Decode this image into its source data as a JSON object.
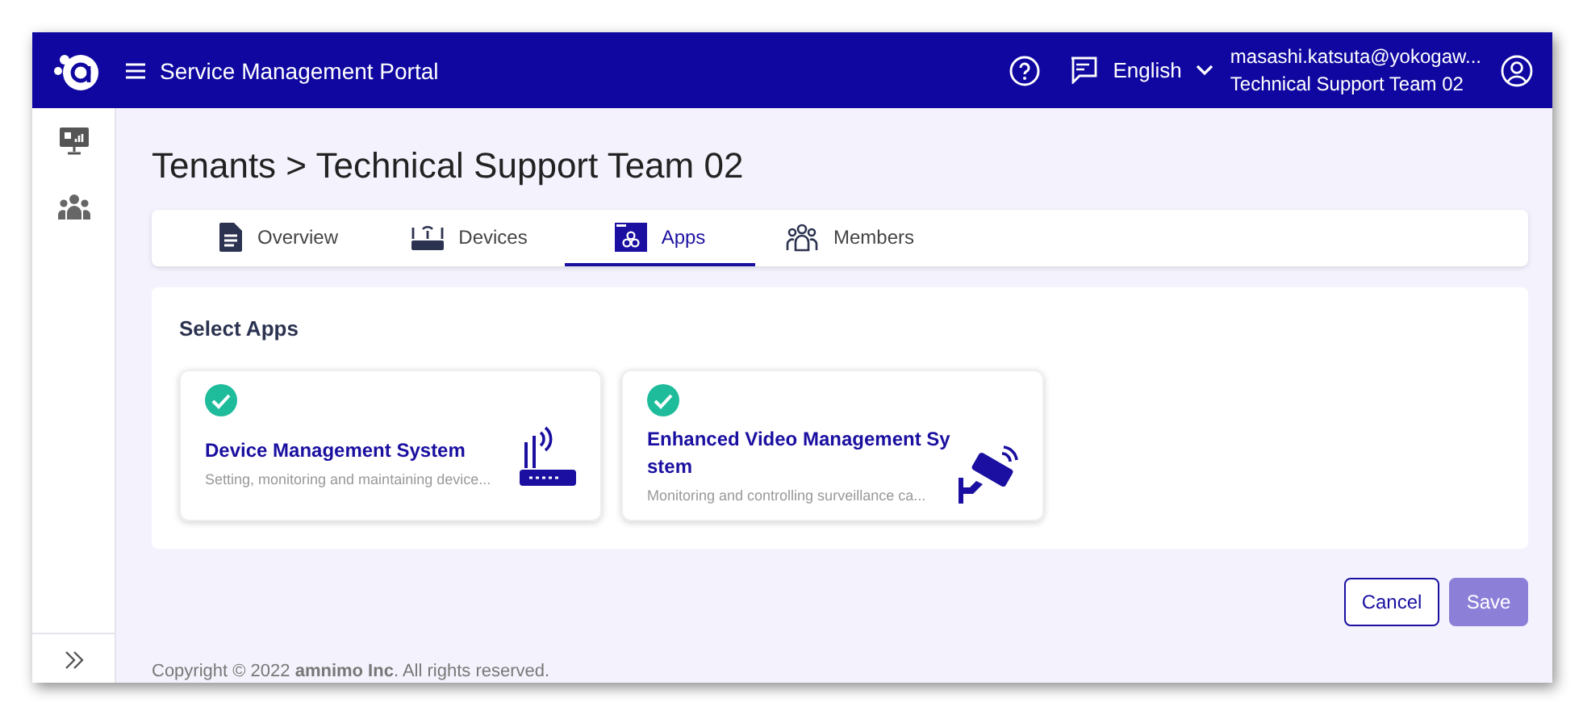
{
  "header": {
    "title": "Service Management Portal",
    "language": "English",
    "user_email": "masashi.katsuta@yokogaw...",
    "user_team": "Technical Support Team 02"
  },
  "sidebar": {
    "items": [
      {
        "kind": "monitor"
      },
      {
        "kind": "people"
      }
    ]
  },
  "breadcrumb": "Tenants > Technical Support Team 02",
  "tabs": [
    {
      "label": "Overview",
      "kind": "document",
      "selected": false
    },
    {
      "label": "Devices",
      "kind": "router",
      "selected": false
    },
    {
      "label": "Apps",
      "kind": "apps",
      "selected": true
    },
    {
      "label": "Members",
      "kind": "people",
      "selected": false
    }
  ],
  "apps_panel": {
    "title": "Select Apps",
    "apps": [
      {
        "title": "Device Management System",
        "description": "Setting, monitoring and maintaining device...",
        "kind": "router",
        "checked": true
      },
      {
        "title": "Enhanced Video Management System",
        "description": "Monitoring and controlling surveillance ca...",
        "kind": "camera",
        "checked": true
      }
    ]
  },
  "buttons": [
    {
      "label": "Cancel",
      "kind": "secondary",
      "disabled": false
    },
    {
      "label": "Save",
      "kind": "primary",
      "disabled": true
    }
  ],
  "footer": "Copyright © 2022 **amnimo Inc**. All rights reserved."
}
